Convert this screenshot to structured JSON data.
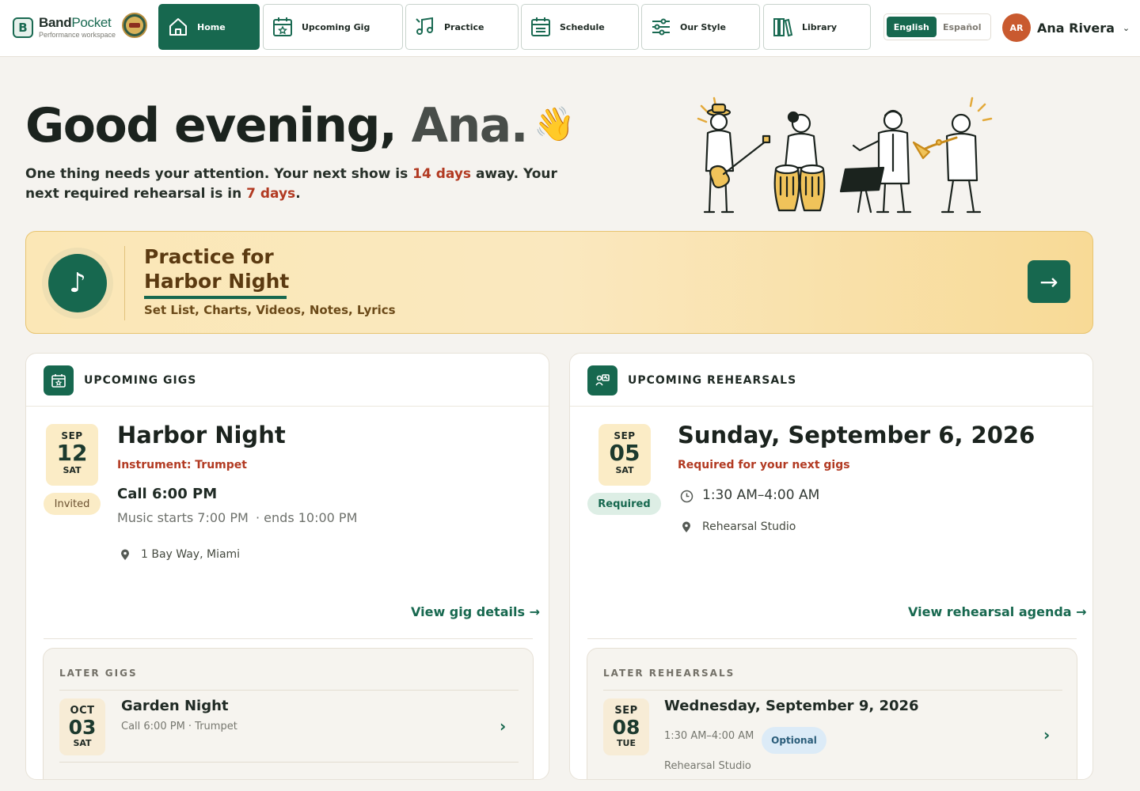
{
  "brand": {
    "name_a": "Band",
    "name_b": "Pocket",
    "mark": "B",
    "tagline": "Performance workspace"
  },
  "nav": [
    {
      "label": "Home",
      "icon": "home-icon",
      "active": true
    },
    {
      "label": "Upcoming Gig",
      "icon": "calendar-star-icon"
    },
    {
      "label": "Practice",
      "icon": "music-notes-icon"
    },
    {
      "label": "Schedule",
      "icon": "calendar-grid-icon"
    },
    {
      "label": "Our Style",
      "icon": "sliders-icon"
    },
    {
      "label": "Library",
      "icon": "books-icon"
    }
  ],
  "language": {
    "active": "English",
    "inactive": "Español"
  },
  "user": {
    "initials": "AR",
    "name": "Ana Rivera"
  },
  "hero": {
    "greeting": "Good evening,",
    "name": "Ana.",
    "wave": "👋",
    "line_a": "One thing needs your attention. Your next show is ",
    "show_days": "14 days",
    "line_b": " away. Your next required rehearsal is in ",
    "rehearsal_days": "7 days",
    "line_c": "."
  },
  "practice": {
    "title_1": "Practice for",
    "title_2": "Harbor Night",
    "subtitle": "Set List, Charts, Videos, Notes, Lyrics",
    "note_icon": "♪",
    "arrow": "→"
  },
  "gigs": {
    "header": "UPCOMING GIGS",
    "next": {
      "month": "SEP",
      "day": "12",
      "weekday": "SAT",
      "status": "Invited",
      "title": "Harbor Night",
      "instrument": "Instrument: Trumpet",
      "call": "Call 6:00 PM",
      "music": "Music starts 7:00 PM",
      "ends": "· ends 10:00 PM",
      "location": "1 Bay Way, Miami",
      "link": "View gig details →"
    },
    "later_title": "LATER GIGS",
    "later": [
      {
        "month": "OCT",
        "day": "03",
        "weekday": "SAT",
        "title": "Garden Night",
        "meta": "Call 6:00 PM · Trumpet"
      }
    ]
  },
  "rehearsals": {
    "header": "UPCOMING REHEARSALS",
    "next": {
      "month": "SEP",
      "day": "05",
      "weekday": "SAT",
      "status": "Required",
      "title": "Sunday, September 6, 2026",
      "subtitle": "Required for your next gigs",
      "time": "1:30 AM–4:00 AM",
      "location": "Rehearsal Studio",
      "link": "View rehearsal agenda →"
    },
    "later_title": "LATER REHEARSALS",
    "later": [
      {
        "month": "SEP",
        "day": "08",
        "weekday": "TUE",
        "title": "Wednesday, September 9, 2026",
        "meta": "1:30 AM–4:00 AM",
        "badge": "Optional",
        "location": "Rehearsal Studio"
      }
    ]
  },
  "colors": {
    "primary": "#17684f",
    "accent_red": "#b23a22",
    "banner": "#fae8bf",
    "avatar": "#c95a2f"
  }
}
